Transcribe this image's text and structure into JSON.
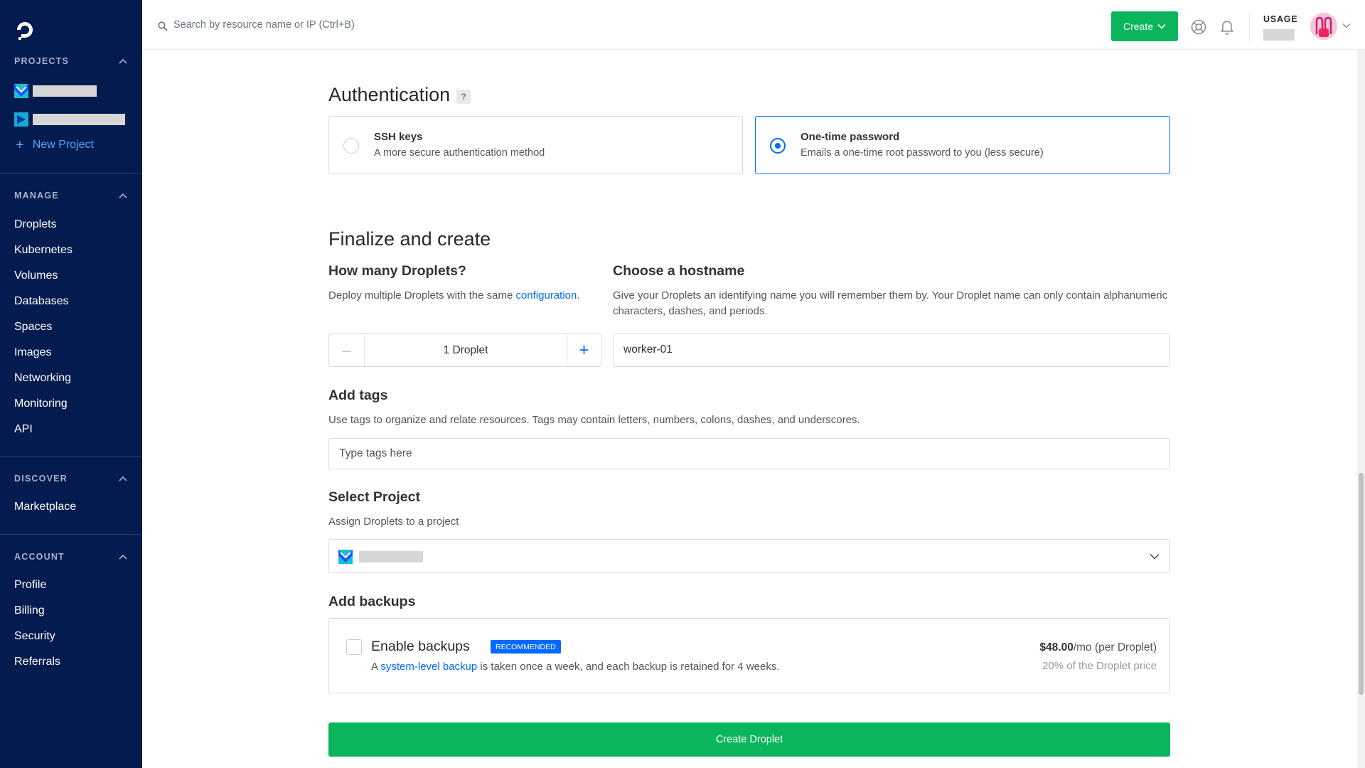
{
  "topbar": {
    "search_placeholder": "Search by resource name or IP (Ctrl+B)",
    "create_label": "Create",
    "usage_label": "USAGE"
  },
  "sidebar": {
    "projects_heading": "PROJECTS",
    "new_project_label": "New Project",
    "manage_heading": "MANAGE",
    "manage_items": [
      "Droplets",
      "Kubernetes",
      "Volumes",
      "Databases",
      "Spaces",
      "Images",
      "Networking",
      "Monitoring",
      "API"
    ],
    "discover_heading": "DISCOVER",
    "discover_items": [
      "Marketplace"
    ],
    "account_heading": "ACCOUNT",
    "account_items": [
      "Profile",
      "Billing",
      "Security",
      "Referrals"
    ]
  },
  "authentication": {
    "heading": "Authentication",
    "help_badge": "?",
    "options": [
      {
        "title": "SSH keys",
        "description": "A more secure authentication method",
        "selected": false
      },
      {
        "title": "One-time password",
        "description": "Emails a one-time root password to you (less secure)",
        "selected": true
      }
    ]
  },
  "finalize": {
    "heading": "Finalize and create",
    "droplets_heading": "How many Droplets?",
    "droplets_desc_prefix": "Deploy multiple Droplets with the same ",
    "droplets_desc_link": "configuration",
    "droplets_desc_suffix": ".",
    "stepper_minus": "–",
    "stepper_plus": "+",
    "droplet_count_value": "1  Droplet",
    "hostname_heading": "Choose a hostname",
    "hostname_desc": "Give your Droplets an identifying name you will remember them by. Your Droplet name can only contain alphanumeric characters, dashes, and periods.",
    "hostname_value": "worker-01"
  },
  "tags": {
    "heading": "Add tags",
    "description": "Use tags to organize and relate resources. Tags may contain letters, numbers, colons, dashes, and underscores.",
    "placeholder": "Type tags here"
  },
  "project": {
    "heading": "Select Project",
    "description": "Assign Droplets to a project"
  },
  "backups": {
    "heading": "Add backups",
    "title": "Enable backups",
    "badge": "RECOMMENDED",
    "desc_prefix": "A ",
    "desc_link": "system-level backup",
    "desc_suffix": " is taken once a week, and each backup is retained for 4 weeks.",
    "price_amount": "$48.00",
    "price_suffix": "/mo (per Droplet)",
    "price_note": "20% of the Droplet price",
    "enabled": false
  },
  "create_droplet_label": "Create Droplet",
  "colors": {
    "sidebar_bg": "#031b4e",
    "primary_blue": "#0069ff",
    "create_green": "#0bb55b"
  }
}
